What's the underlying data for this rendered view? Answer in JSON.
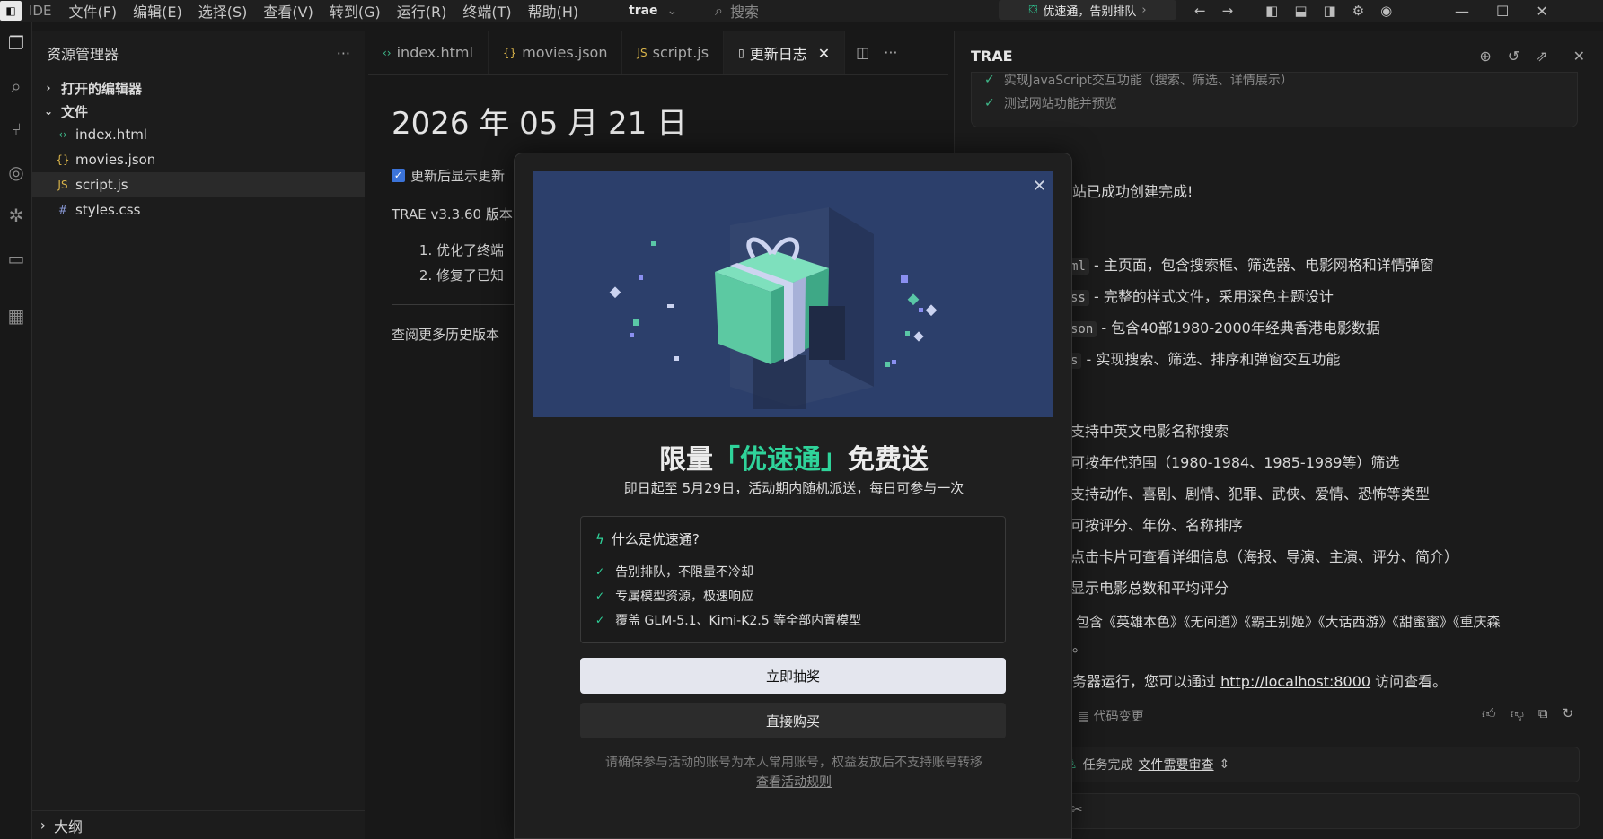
{
  "titlebar": {
    "brand": "IDE",
    "menu": [
      "文件(F)",
      "编辑(E)",
      "选择(S)",
      "查看(V)",
      "转到(G)",
      "运行(R)",
      "终端(T)",
      "帮助(H)"
    ],
    "workspace": "trae",
    "search_placeholder": "搜索",
    "promo_label": "优速通，告别排队"
  },
  "explorer": {
    "title": "资源管理器",
    "open_editors": "打开的编辑器",
    "folder": "文件",
    "files": [
      {
        "name": "index.html",
        "icon": "‹›"
      },
      {
        "name": "movies.json",
        "icon": "{}"
      },
      {
        "name": "script.js",
        "icon": "JS"
      },
      {
        "name": "styles.css",
        "icon": "#"
      }
    ],
    "outline": "大纲"
  },
  "editor": {
    "tabs": [
      {
        "label": "index.html",
        "icon": "‹›"
      },
      {
        "label": "movies.json",
        "icon": "{}"
      },
      {
        "label": "script.js",
        "icon": "JS"
      },
      {
        "label": "更新日志",
        "icon": "▯"
      }
    ],
    "doc_title": "2026 年 05 月 21 日",
    "checkbox_label": "更新后显示更新",
    "version_line": "TRAE v3.3.60 版本",
    "items": [
      "优化了终端",
      "修复了已知"
    ],
    "more_link": "查阅更多历史版本"
  },
  "ai_panel": {
    "title": "TRAE",
    "tasks": [
      "实现JavaScript交互功能（搜索、筛选、详情展示）",
      "测试网站功能并预览"
    ],
    "lines": {
      "done": "站已成功创建完成!",
      "f1_code": "ml",
      "f1_text": "- 主页面，包含搜索框、筛选器、电影网格和详情弹窗",
      "f2_code": "ss",
      "f2_text": "- 完整的样式文件，采用深色主题设计",
      "f3_code": "son",
      "f3_text": "- 包含40部1980-2000年经典香港电影数据",
      "f4_code": "s",
      "f4_text": "- 实现搜索、筛选、排序和弹窗交互功能",
      "feat1": "支持中英文电影名称搜索",
      "feat2": "可按年代范围（1980-1984、1985-1989等）筛选",
      "feat3": "支持动作、喜剧、剧情、犯罪、武侠、爱情、恐怖等类型",
      "feat4": "可按评分、年份、名称排序",
      "feat5": "点击卡片可查看详细信息（海报、导演、主演、评分、简介）",
      "feat6": "显示电影总数和平均评分",
      "movies": "包含《英雄本色》《无间道》《霸王别姬》《大话西游》《甜蜜蜜》《重庆森",
      "movies_end": "。",
      "server_prefix": "务器运行，您可以通过",
      "server_link": "http://localhost:8000",
      "server_suffix": "访问查看。",
      "code_change": "代码变更"
    },
    "status_done": "任务完成",
    "status_link": "文件需要审查"
  },
  "modal": {
    "title_pre": "限量",
    "title_hl": "「优速通」",
    "title_post": "免费送",
    "subtitle": "即日起至 5月29日，活动期内随机派送，每日可参与一次",
    "box_title": "什么是优速通?",
    "features": [
      "告别排队，不限量不冷却",
      "专属模型资源，极速响应",
      "覆盖 GLM-5.1、Kimi-K2.5 等全部内置模型"
    ],
    "primary_button": "立即抽奖",
    "secondary_button": "直接购买",
    "note": "请确保参与活动的账号为本人常用账号，权益发放后不支持账号转移",
    "rules_link": "查看活动规则"
  },
  "colors": {
    "accent_green": "#2fd39a",
    "banner_bg": "#2c3f6b",
    "bg": "#181818"
  }
}
